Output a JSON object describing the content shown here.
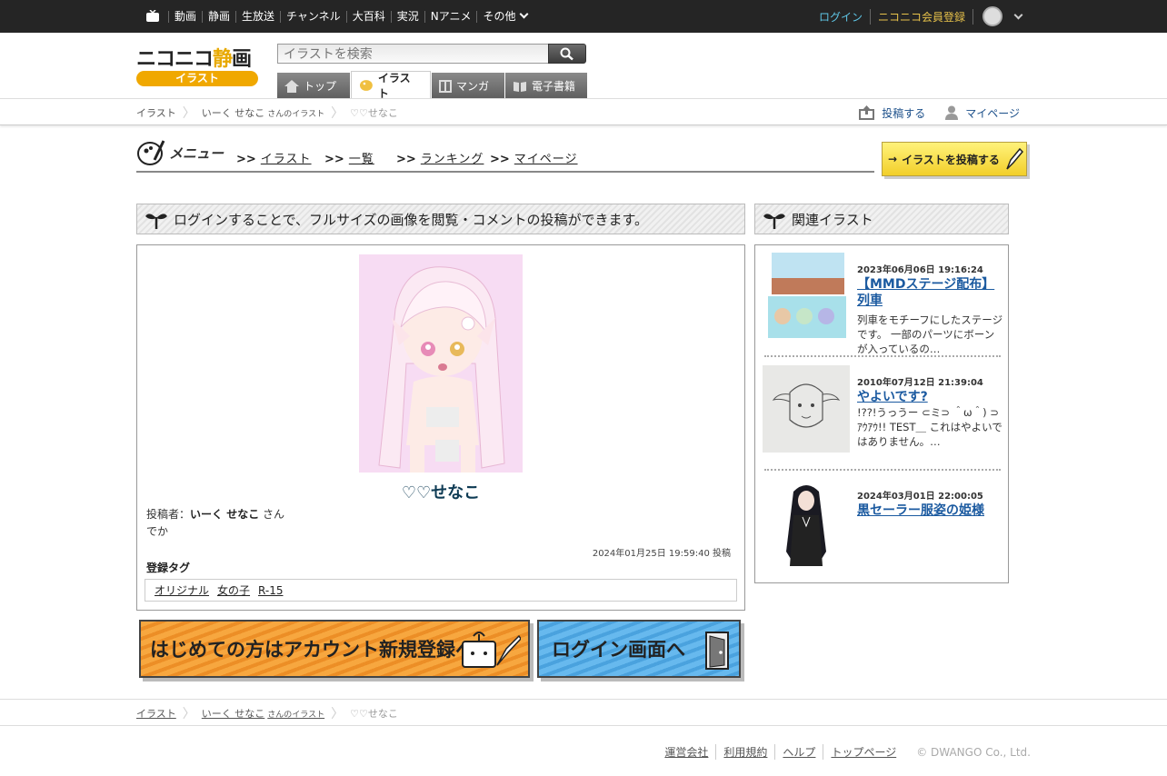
{
  "topbar": {
    "nav": [
      "動画",
      "静画",
      "生放送",
      "チャンネル",
      "大百科",
      "実況",
      "Nアニメ",
      "その他"
    ],
    "login": "ログイン",
    "register": "ニコニコ会員登録"
  },
  "header": {
    "logo_main_a": "ニコニコ",
    "logo_main_b": "静",
    "logo_main_c": "画",
    "logo_badge": "イラスト",
    "search_placeholder": "イラストを検索",
    "tabs": [
      "トップ",
      "イラスト",
      "マンガ",
      "電子書籍"
    ]
  },
  "breadcrumb": {
    "root": "イラスト",
    "user": "いーく せなこ",
    "user_suffix": "さんのイラスト",
    "current": "♡♡せなこ",
    "post": "投稿する",
    "mypage": "マイページ"
  },
  "menu": {
    "label": "メニュー",
    "items": [
      "イラスト",
      "一覧",
      "ランキング",
      "マイページ"
    ],
    "post_button": "イラストを投稿する"
  },
  "notice": "ログインすることで、フルサイズの画像を閲覧・コメントの投稿ができます。",
  "related_heading": "関連イラスト",
  "artwork": {
    "title": "♡♡せなこ",
    "poster_label": "投稿者：",
    "poster_name": "いーく せなこ",
    "poster_suffix": "さん",
    "description": "でか",
    "posted_at": "2024年01月25日 19:59:40 投稿",
    "tags_label": "登録タグ",
    "tags": [
      "オリジナル",
      "女の子",
      "R-15"
    ]
  },
  "cta": {
    "register": "はじめての方はアカウント新規登録へ",
    "login": "ログイン画面へ"
  },
  "related": [
    {
      "date": "2023年06月06日 19:16:24",
      "title": "【MMDステージ配布】列車",
      "desc": "列車をモチーフにしたステージです。 一部のパーツにボーンが入っているの…"
    },
    {
      "date": "2010年07月12日 21:39:04",
      "title": "やよいです?",
      "desc": "!??!うっうー ⊂ミ⊃ ＾ω＾) ⊃　ｱｳｱｳ!! TEST＿ これはやよいではありません。…"
    },
    {
      "date": "2024年03月01日 22:00:05",
      "title": "黒セーラー服姿の姫様",
      "desc": ""
    }
  ],
  "footer": {
    "links": [
      "運営会社",
      "利用規約",
      "ヘルプ",
      "トップページ"
    ],
    "copyright": "© DWANGO Co., Ltd."
  }
}
